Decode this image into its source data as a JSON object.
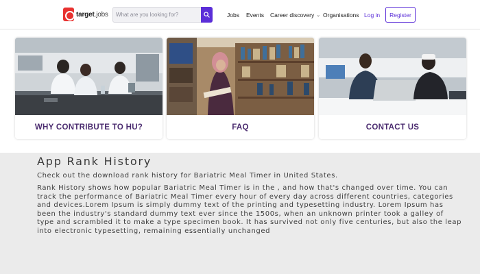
{
  "header": {
    "logo_text": "target",
    "logo_suffix": "jobs",
    "search_placeholder": "What are you looking for?",
    "nav": {
      "jobs": "Jobs",
      "events": "Events",
      "career": "Career discovery",
      "organisations": "Organisations",
      "login": "Log in"
    },
    "register": "Register"
  },
  "cards": [
    {
      "title": "WHY CONTRIBUTE TO HU?"
    },
    {
      "title": "FAQ"
    },
    {
      "title": "CONTACT US"
    }
  ],
  "content": {
    "heading": "App Rank History",
    "subtitle": "Check out the download rank history for Bariatric Meal Timer in United States.",
    "body": "Rank History shows how popular Bariatric Meal Timer is in the , and how that's changed over time. You can track the performance of Bariatric Meal Timer every hour of every day across different countries, categories and devices.Lorem Ipsum is simply dummy text of the printing and typesetting industry. Lorem Ipsum has been the industry's standard dummy text ever since the 1500s, when an unknown printer took a galley of type and scrambled it to make a type specimen book. It has survived not only five centuries, but also the leap into electronic typesetting, remaining essentially unchanged"
  },
  "colors": {
    "brand_purple": "#5b2ed8",
    "logo_red": "#e8312f",
    "card_title": "#4a2b6f",
    "background": "#ebebeb"
  },
  "icons": {
    "search_button": "search-icon",
    "career_dropdown": "chevron-down-icon"
  }
}
